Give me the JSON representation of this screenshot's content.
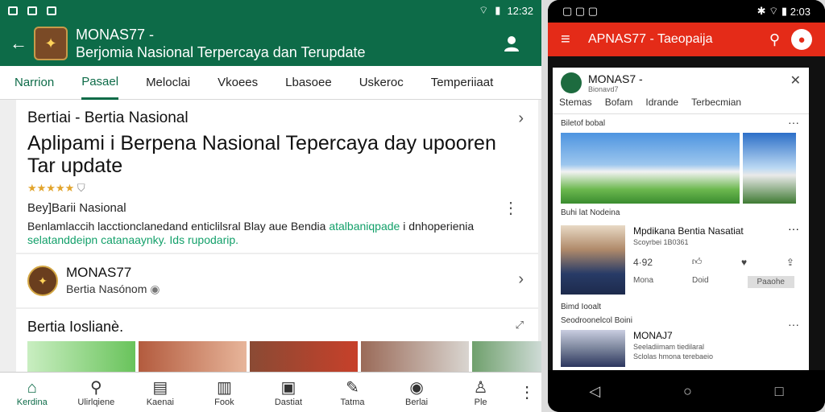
{
  "status_left": {
    "time": "12:32"
  },
  "app": {
    "title_line1": "MONAS77 -",
    "title_line2": "Berjomia Nasional Terpercaya dan Terupdate"
  },
  "tabs": [
    "Narrion",
    "Pasael",
    "Meloclai",
    "Vkoees",
    "Lbasoee",
    "Uskeroc",
    "Temperiiaat"
  ],
  "card1": {
    "head": "Bertiai - Bertia Nasional",
    "title": "Aplipami i Berpena Nasional Tepercaya day upooren Tar update",
    "stars": "★★★★★",
    "sub": "Bey]Barii Nasional",
    "desc_a": "Benlamlaccih lacctionclanedand enticlilsral Blay aue Bendia",
    "desc_hl1": "atalbaniqpade",
    "desc_b": "i dnhoperienia",
    "desc_hl2": "selatanddeipn catanaaynky. Ids rupodarip."
  },
  "card2": {
    "name": "MONAS77",
    "sub": "Bertia Nasónom"
  },
  "card3": {
    "head": "Bertia Ioslianè."
  },
  "bottom_nav": [
    {
      "label": "Kerdina",
      "icon": "home-icon",
      "glyph": "⌂"
    },
    {
      "label": "Ulirlqiene",
      "icon": "search-icon",
      "glyph": "⚲"
    },
    {
      "label": "Kaenai",
      "icon": "news-icon",
      "glyph": "▤"
    },
    {
      "label": "Fook",
      "icon": "book-icon",
      "glyph": "▥"
    },
    {
      "label": "Dastiat",
      "icon": "chat-icon",
      "glyph": "▣"
    },
    {
      "label": "Tatma",
      "icon": "edit-icon",
      "glyph": "✎"
    },
    {
      "label": "Berlai",
      "icon": "badge-icon",
      "glyph": "◉"
    },
    {
      "label": "Ple",
      "icon": "profile-icon",
      "glyph": "♙"
    }
  ],
  "phone": {
    "time": "2:03",
    "title": "APNAS77 - Taeopaija",
    "brand": "MONAS7 -",
    "brand_sub": "Bionavd7",
    "tabs": [
      "Stemas",
      "Bofam",
      "Idrande",
      "Terbecmian"
    ],
    "section1": "Biletof bobal",
    "section2": "Buhi lat Nodeina",
    "item1_title": "Mpdikana Bentia Nasatiat",
    "item1_sub": "Scoyrbei 1B0361",
    "item1_count": "4·92",
    "item1_btn1": "Mona",
    "item1_btn2": "Doid",
    "item1_btn3": "Paaohe",
    "section3": "Bimd Iooalt",
    "section4": "Seodroonelcol Boini",
    "item2_title": "MONAJ7",
    "item2_line1": "Seeladiimam tiedilaral",
    "item2_line2": "Sclolas hmona terebaeio"
  }
}
